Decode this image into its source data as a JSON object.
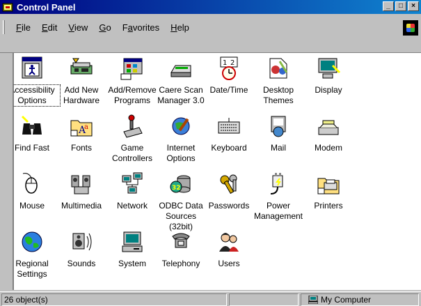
{
  "window": {
    "title": "Control Panel",
    "buttons": [
      "_",
      "□",
      "×"
    ]
  },
  "menu": [
    "File",
    "Edit",
    "View",
    "Go",
    "Favorites",
    "Help"
  ],
  "menu_underline": [
    "F",
    "E",
    "V",
    "G",
    "a",
    "H"
  ],
  "items": [
    {
      "label": "Accessibility Options",
      "icon": "accessibility-icon"
    },
    {
      "label": "Add New Hardware",
      "icon": "add-hardware-icon"
    },
    {
      "label": "Add/Remove Programs",
      "icon": "add-remove-programs-icon"
    },
    {
      "label": "Caere Scan Manager 3.0",
      "icon": "scanner-icon"
    },
    {
      "label": "Date/Time",
      "icon": "clock-icon"
    },
    {
      "label": "Desktop Themes",
      "icon": "desktop-themes-icon"
    },
    {
      "label": "Display",
      "icon": "display-icon"
    },
    {
      "label": "Find Fast",
      "icon": "binoculars-icon"
    },
    {
      "label": "Fonts",
      "icon": "fonts-folder-icon"
    },
    {
      "label": "Game Controllers",
      "icon": "joystick-icon"
    },
    {
      "label": "Internet Options",
      "icon": "internet-options-icon"
    },
    {
      "label": "Keyboard",
      "icon": "keyboard-icon"
    },
    {
      "label": "Mail",
      "icon": "mail-icon"
    },
    {
      "label": "Modem",
      "icon": "modem-icon"
    },
    {
      "label": "Mouse",
      "icon": "mouse-icon"
    },
    {
      "label": "Multimedia",
      "icon": "multimedia-icon"
    },
    {
      "label": "Network",
      "icon": "network-icon"
    },
    {
      "label": "ODBC Data Sources (32bit)",
      "icon": "odbc-icon"
    },
    {
      "label": "Passwords",
      "icon": "keys-icon"
    },
    {
      "label": "Power Management",
      "icon": "power-plug-icon"
    },
    {
      "label": "Printers",
      "icon": "printer-folder-icon"
    },
    {
      "label": "Regional Settings",
      "icon": "globe-icon"
    },
    {
      "label": "Sounds",
      "icon": "speaker-icon"
    },
    {
      "label": "System",
      "icon": "computer-icon"
    },
    {
      "label": "Telephony",
      "icon": "telephone-icon"
    },
    {
      "label": "Users",
      "icon": "users-icon"
    }
  ],
  "status": {
    "count": "26 object(s)",
    "zone": "My Computer"
  }
}
